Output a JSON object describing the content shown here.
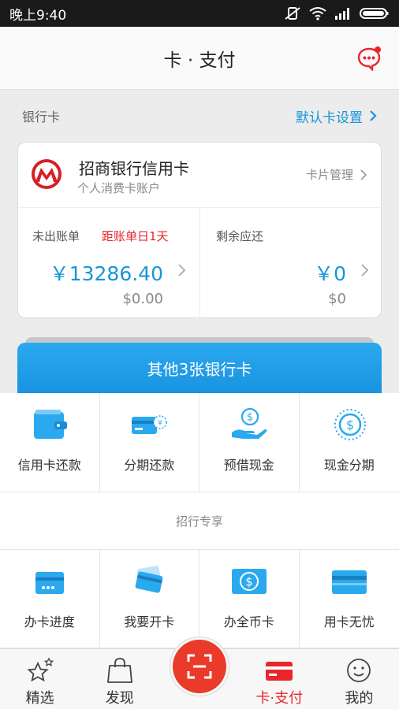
{
  "status": {
    "time": "晚上9:40"
  },
  "nav": {
    "title": "卡 · 支付"
  },
  "section": {
    "label": "银行卡",
    "default_link": "默认卡设置"
  },
  "card": {
    "name": "招商银行信用卡",
    "subtitle": "个人消费卡账户",
    "manage": "卡片管理",
    "unbilled_label": "未出账单",
    "due_text": "距账单日1天",
    "unbilled_amount": "￥13286.40",
    "unbilled_usd": "$0.00",
    "remaining_label": "剩余应还",
    "remaining_amount": "￥0",
    "remaining_usd": "$0"
  },
  "other_cards": "其他3张银行卡",
  "services": [
    {
      "label": "信用卡还款",
      "icon": "wallet-icon"
    },
    {
      "label": "分期还款",
      "icon": "installment-card-icon"
    },
    {
      "label": "预借现金",
      "icon": "cash-hand-icon"
    },
    {
      "label": "现金分期",
      "icon": "dollar-coin-icon"
    }
  ],
  "exclusive_title": "招行专享",
  "exclusive": [
    {
      "label": "办卡进度",
      "icon": "card-progress-icon"
    },
    {
      "label": "我要开卡",
      "icon": "open-card-icon"
    },
    {
      "label": "办全币卡",
      "icon": "currency-card-icon"
    },
    {
      "label": "用卡无忧",
      "icon": "card-protect-icon"
    }
  ],
  "tabs": [
    {
      "label": "精选",
      "icon": "stars-icon"
    },
    {
      "label": "发现",
      "icon": "shopping-bag-icon"
    },
    {
      "label": "卡·支付",
      "icon": "card-pay-icon",
      "active": true
    },
    {
      "label": "我的",
      "icon": "smiley-icon"
    }
  ],
  "colors": {
    "accent_blue": "#1596d9",
    "brand_red": "#e8262b",
    "scan_red": "#ea3a2a"
  }
}
